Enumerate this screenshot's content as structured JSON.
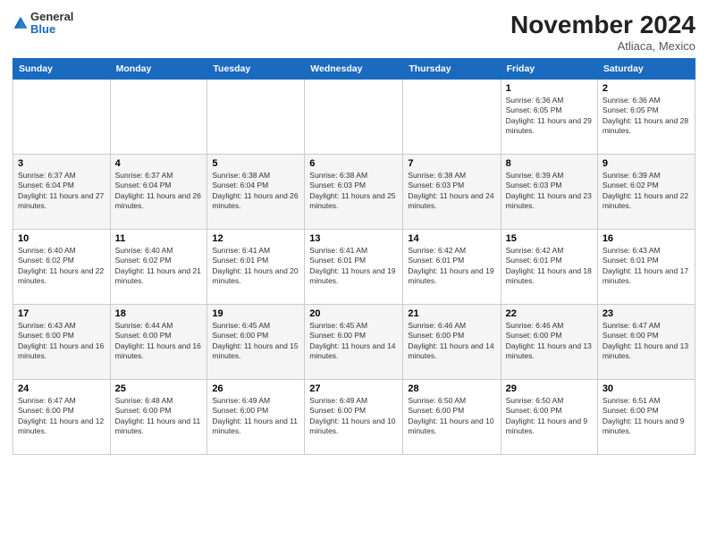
{
  "logo": {
    "general": "General",
    "blue": "Blue"
  },
  "header": {
    "month": "November 2024",
    "location": "Atliaca, Mexico"
  },
  "weekdays": [
    "Sunday",
    "Monday",
    "Tuesday",
    "Wednesday",
    "Thursday",
    "Friday",
    "Saturday"
  ],
  "weeks": [
    [
      {
        "day": "",
        "info": ""
      },
      {
        "day": "",
        "info": ""
      },
      {
        "day": "",
        "info": ""
      },
      {
        "day": "",
        "info": ""
      },
      {
        "day": "",
        "info": ""
      },
      {
        "day": "1",
        "info": "Sunrise: 6:36 AM\nSunset: 6:05 PM\nDaylight: 11 hours and 29 minutes."
      },
      {
        "day": "2",
        "info": "Sunrise: 6:36 AM\nSunset: 6:05 PM\nDaylight: 11 hours and 28 minutes."
      }
    ],
    [
      {
        "day": "3",
        "info": "Sunrise: 6:37 AM\nSunset: 6:04 PM\nDaylight: 11 hours and 27 minutes."
      },
      {
        "day": "4",
        "info": "Sunrise: 6:37 AM\nSunset: 6:04 PM\nDaylight: 11 hours and 26 minutes."
      },
      {
        "day": "5",
        "info": "Sunrise: 6:38 AM\nSunset: 6:04 PM\nDaylight: 11 hours and 26 minutes."
      },
      {
        "day": "6",
        "info": "Sunrise: 6:38 AM\nSunset: 6:03 PM\nDaylight: 11 hours and 25 minutes."
      },
      {
        "day": "7",
        "info": "Sunrise: 6:38 AM\nSunset: 6:03 PM\nDaylight: 11 hours and 24 minutes."
      },
      {
        "day": "8",
        "info": "Sunrise: 6:39 AM\nSunset: 6:03 PM\nDaylight: 11 hours and 23 minutes."
      },
      {
        "day": "9",
        "info": "Sunrise: 6:39 AM\nSunset: 6:02 PM\nDaylight: 11 hours and 22 minutes."
      }
    ],
    [
      {
        "day": "10",
        "info": "Sunrise: 6:40 AM\nSunset: 6:02 PM\nDaylight: 11 hours and 22 minutes."
      },
      {
        "day": "11",
        "info": "Sunrise: 6:40 AM\nSunset: 6:02 PM\nDaylight: 11 hours and 21 minutes."
      },
      {
        "day": "12",
        "info": "Sunrise: 6:41 AM\nSunset: 6:01 PM\nDaylight: 11 hours and 20 minutes."
      },
      {
        "day": "13",
        "info": "Sunrise: 6:41 AM\nSunset: 6:01 PM\nDaylight: 11 hours and 19 minutes."
      },
      {
        "day": "14",
        "info": "Sunrise: 6:42 AM\nSunset: 6:01 PM\nDaylight: 11 hours and 19 minutes."
      },
      {
        "day": "15",
        "info": "Sunrise: 6:42 AM\nSunset: 6:01 PM\nDaylight: 11 hours and 18 minutes."
      },
      {
        "day": "16",
        "info": "Sunrise: 6:43 AM\nSunset: 6:01 PM\nDaylight: 11 hours and 17 minutes."
      }
    ],
    [
      {
        "day": "17",
        "info": "Sunrise: 6:43 AM\nSunset: 6:00 PM\nDaylight: 11 hours and 16 minutes."
      },
      {
        "day": "18",
        "info": "Sunrise: 6:44 AM\nSunset: 6:00 PM\nDaylight: 11 hours and 16 minutes."
      },
      {
        "day": "19",
        "info": "Sunrise: 6:45 AM\nSunset: 6:00 PM\nDaylight: 11 hours and 15 minutes."
      },
      {
        "day": "20",
        "info": "Sunrise: 6:45 AM\nSunset: 6:00 PM\nDaylight: 11 hours and 14 minutes."
      },
      {
        "day": "21",
        "info": "Sunrise: 6:46 AM\nSunset: 6:00 PM\nDaylight: 11 hours and 14 minutes."
      },
      {
        "day": "22",
        "info": "Sunrise: 6:46 AM\nSunset: 6:00 PM\nDaylight: 11 hours and 13 minutes."
      },
      {
        "day": "23",
        "info": "Sunrise: 6:47 AM\nSunset: 6:00 PM\nDaylight: 11 hours and 13 minutes."
      }
    ],
    [
      {
        "day": "24",
        "info": "Sunrise: 6:47 AM\nSunset: 6:00 PM\nDaylight: 11 hours and 12 minutes."
      },
      {
        "day": "25",
        "info": "Sunrise: 6:48 AM\nSunset: 6:00 PM\nDaylight: 11 hours and 11 minutes."
      },
      {
        "day": "26",
        "info": "Sunrise: 6:49 AM\nSunset: 6:00 PM\nDaylight: 11 hours and 11 minutes."
      },
      {
        "day": "27",
        "info": "Sunrise: 6:49 AM\nSunset: 6:00 PM\nDaylight: 11 hours and 10 minutes."
      },
      {
        "day": "28",
        "info": "Sunrise: 6:50 AM\nSunset: 6:00 PM\nDaylight: 11 hours and 10 minutes."
      },
      {
        "day": "29",
        "info": "Sunrise: 6:50 AM\nSunset: 6:00 PM\nDaylight: 11 hours and 9 minutes."
      },
      {
        "day": "30",
        "info": "Sunrise: 6:51 AM\nSunset: 6:00 PM\nDaylight: 11 hours and 9 minutes."
      }
    ]
  ]
}
